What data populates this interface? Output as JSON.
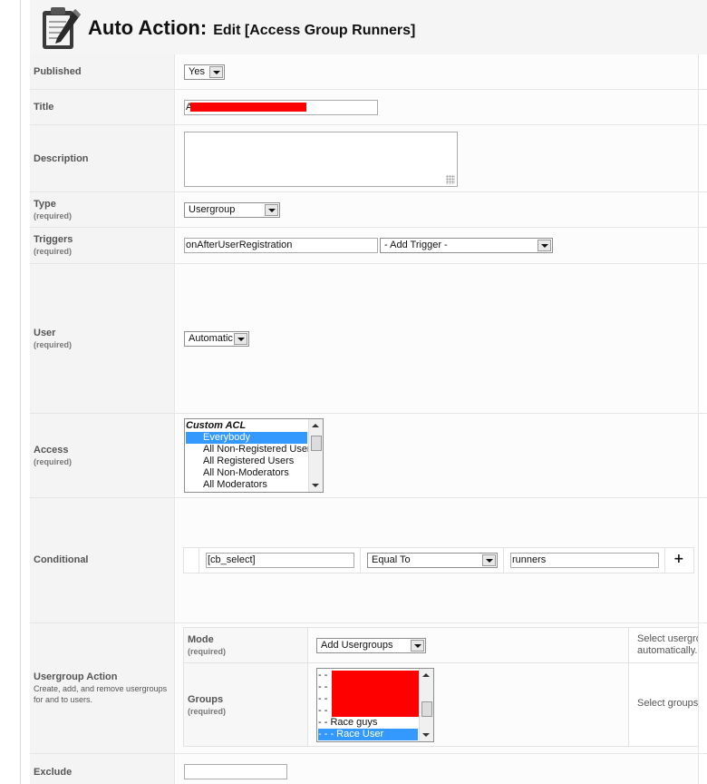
{
  "header": {
    "icon": "clipboard-pencil-icon",
    "title": "Auto Action:",
    "subtitle": "Edit [Access Group Runners]"
  },
  "fields": {
    "published": {
      "label": "Published",
      "value": "Yes"
    },
    "title": {
      "label": "Title",
      "value": "A"
    },
    "description": {
      "label": "Description",
      "value": ""
    },
    "type": {
      "label": "Type",
      "required": "(required)",
      "value": "Usergroup"
    },
    "triggers": {
      "label": "Triggers",
      "required": "(required)",
      "value": "onAfterUserRegistration",
      "add_trigger": "- Add Trigger -"
    },
    "user": {
      "label": "User",
      "required": "(required)",
      "value": "Automatic"
    },
    "access": {
      "label": "Access",
      "required": "(required)",
      "options": [
        {
          "text": "Custom ACL",
          "selected": false,
          "group": true
        },
        {
          "text": "Everybody",
          "selected": true,
          "group": false
        },
        {
          "text": "All Non-Registered Users",
          "selected": false,
          "group": false
        },
        {
          "text": "All Registered Users",
          "selected": false,
          "group": false
        },
        {
          "text": "All Non-Moderators",
          "selected": false,
          "group": false
        },
        {
          "text": "All Moderators",
          "selected": false,
          "group": false
        }
      ]
    },
    "conditional": {
      "label": "Conditional",
      "field": "[cb_select]",
      "operator": "Equal To",
      "value": "runners",
      "add": "+"
    },
    "usergroup_action": {
      "label": "Usergroup Action",
      "description": "Create, add, and remove usergroups for and to users.",
      "mode": {
        "label": "Mode",
        "required": "(required)",
        "value": "Add Usergroups",
        "hint": "Select usergroup automatically."
      },
      "groups": {
        "label": "Groups",
        "required": "(required)",
        "options": [
          {
            "text": "- -",
            "selected": false
          },
          {
            "text": "- -",
            "selected": false
          },
          {
            "text": "- -",
            "selected": false
          },
          {
            "text": "- -",
            "selected": false
          },
          {
            "text": "- - Race guys",
            "selected": false
          },
          {
            "text": "- - - Race User",
            "selected": true
          }
        ],
        "hint": "Select groups to"
      }
    },
    "exclude": {
      "label": "Exclude",
      "value": ""
    }
  }
}
